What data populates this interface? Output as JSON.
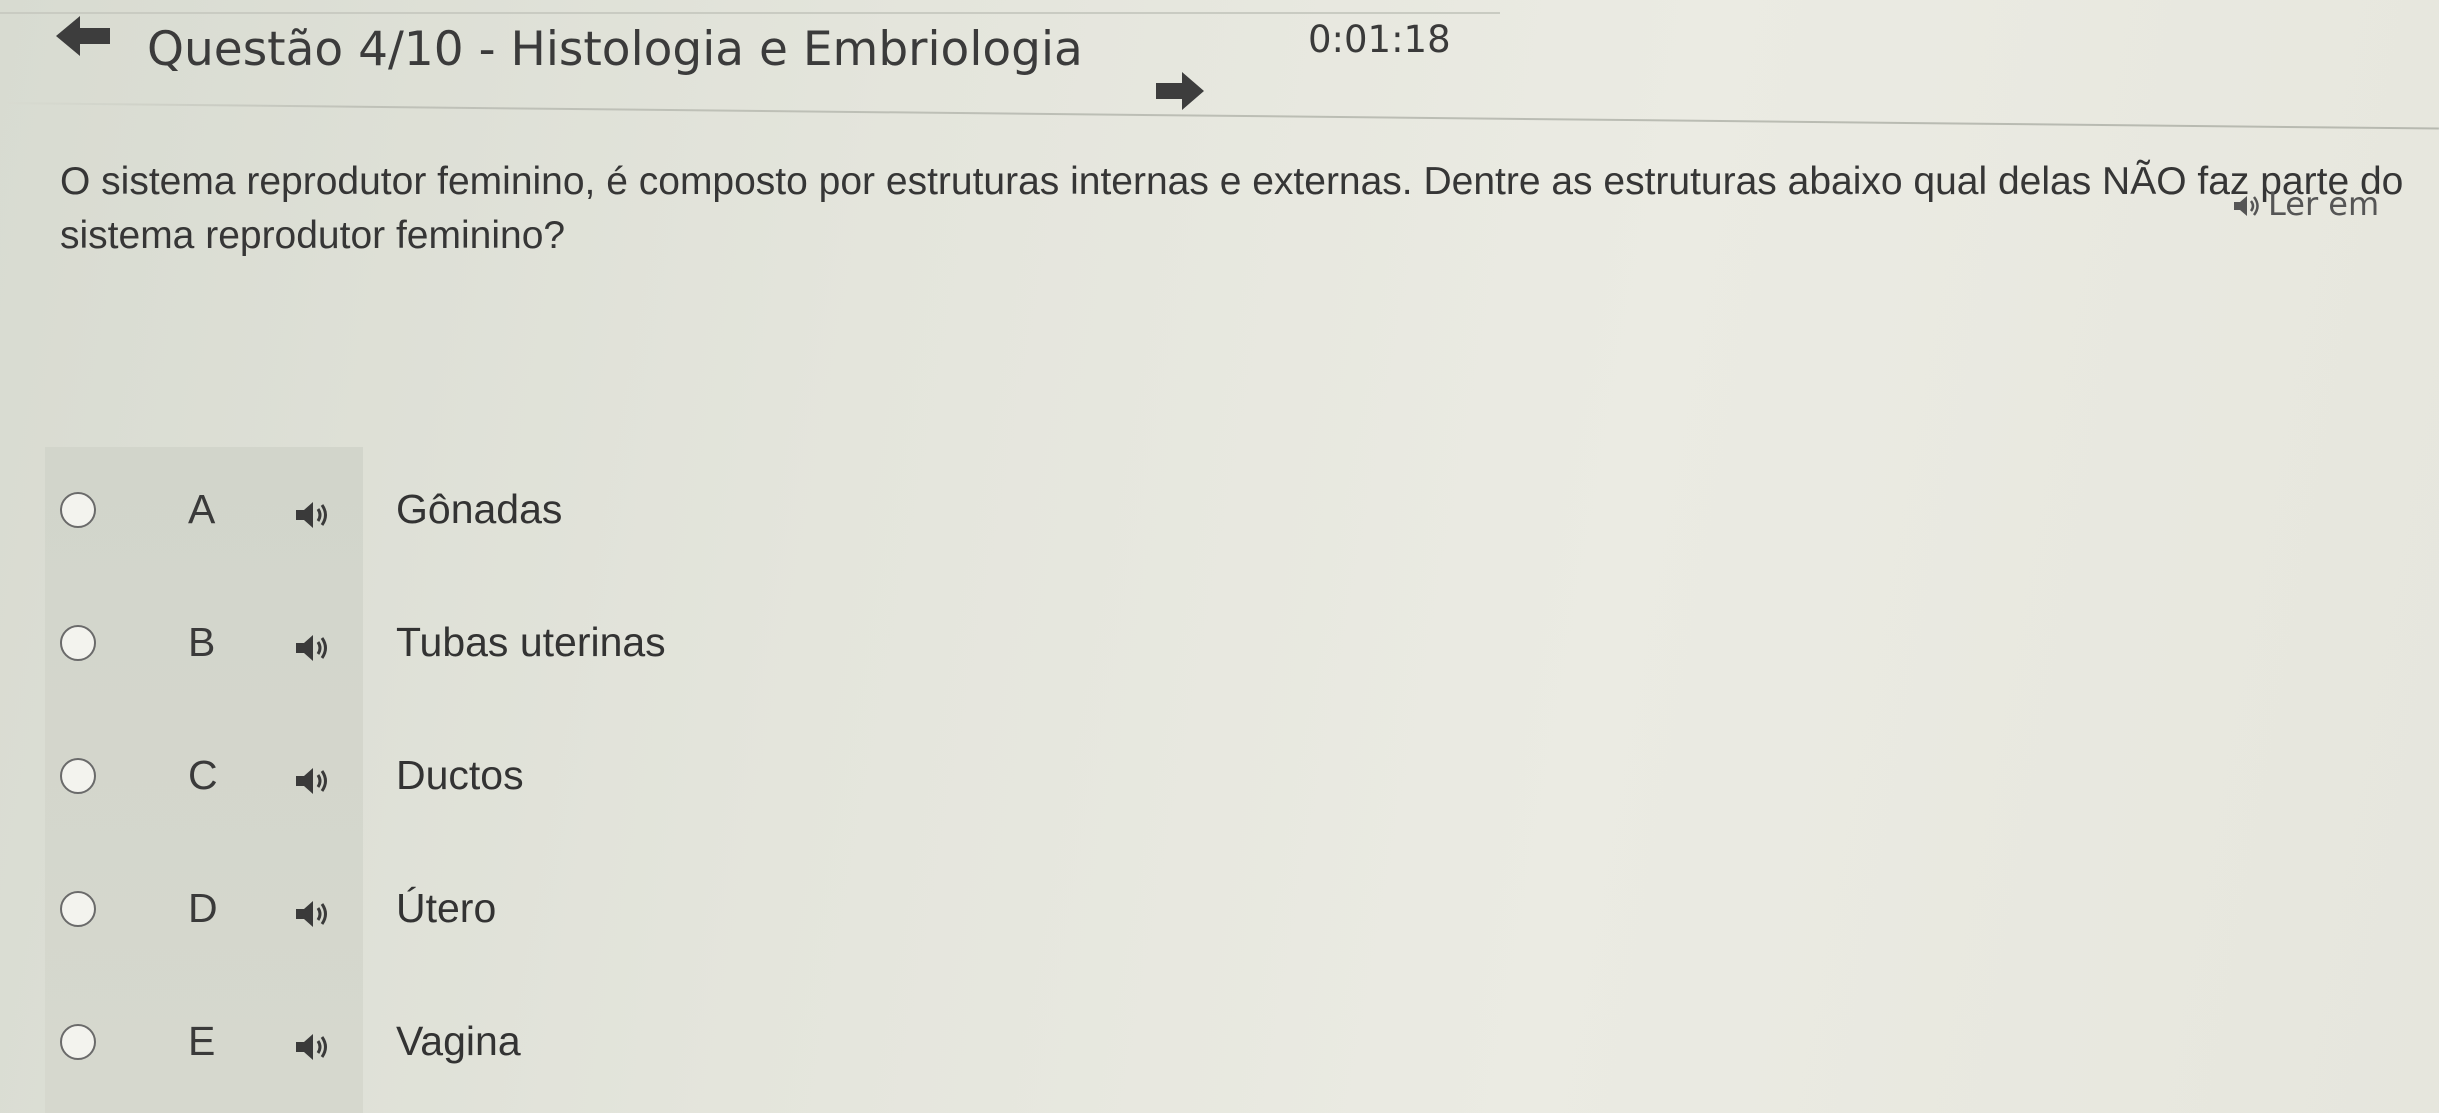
{
  "timer": "0:01:18",
  "header": {
    "title": "Questão 4/10 - Histologia e Embriologia",
    "back_icon": "arrow-left-icon",
    "next_icon": "arrow-right-icon"
  },
  "question": {
    "line1": "O sistema reprodutor feminino, é composto por estruturas internas e externas. Dentre as estruturas abaixo qual delas NÃO faz parte do",
    "line2": "sistema reprodutor feminino?"
  },
  "read_aloud": {
    "label": "Ler em",
    "icon": "speaker-icon"
  },
  "options": [
    {
      "letter": "A",
      "text": "Gônadas"
    },
    {
      "letter": "B",
      "text": "Tubas uterinas"
    },
    {
      "letter": "C",
      "text": "Ductos"
    },
    {
      "letter": "D",
      "text": "Útero"
    },
    {
      "letter": "E",
      "text": "Vagina"
    }
  ],
  "colors": {
    "background": "#e3e4da",
    "text": "#333333",
    "options_strip": "#d4d6cc"
  }
}
